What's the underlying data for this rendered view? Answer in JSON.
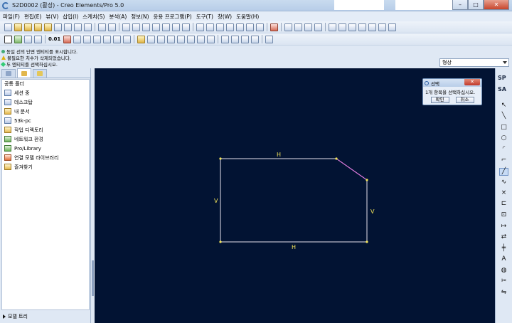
{
  "window": {
    "title": "S2D0002 (활성) - Creo Elements/Pro 5.0"
  },
  "menubar": [
    "파일(F)",
    "편집(E)",
    "뷰(V)",
    "삽입(I)",
    "스케치(S)",
    "분석(A)",
    "정보(N)",
    "응용 프로그램(P)",
    "도구(T)",
    "창(W)",
    "도움말(H)"
  ],
  "toolbar": {
    "scale_label": "0.01"
  },
  "messages": [
    "동일 선의 단면 엔티티를 표시합니다.",
    "불필요한 치수가 삭제되었습니다.",
    "두 엔티티를 선택하십시오."
  ],
  "filter": {
    "selected": "형상"
  },
  "left_panel": {
    "header": "공통 폴더",
    "folders": [
      {
        "label": "세션 중",
        "icon": "session-icon"
      },
      {
        "label": "데스크탑",
        "icon": "desktop-icon"
      },
      {
        "label": "내 문서",
        "icon": "documents-icon"
      },
      {
        "label": "53k-pc",
        "icon": "computer-icon"
      },
      {
        "label": "작업 디렉토리",
        "icon": "working-directory-icon"
      },
      {
        "label": "네트워크 환경",
        "icon": "network-icon"
      },
      {
        "label": "Pro/Library",
        "icon": "library-icon"
      },
      {
        "label": "연결 모델 라이브러리",
        "icon": "model-library-icon"
      },
      {
        "label": "즐겨찾기",
        "icon": "favorites-icon"
      }
    ],
    "model_tree_label": "모델 트리"
  },
  "sketch": {
    "labels": [
      {
        "name": "dim-top",
        "text": "H"
      },
      {
        "name": "dim-bottom",
        "text": "H"
      },
      {
        "name": "dim-left",
        "text": "V"
      },
      {
        "name": "dim-right",
        "text": "V"
      }
    ],
    "colors": {
      "background": "#021333",
      "lines": "#e7e1ec",
      "chamfer": "#e46ee0",
      "points": "#f3e45a",
      "labels": "#f3e45a"
    }
  },
  "dialog": {
    "title": "선택",
    "message": "1개 항목을 선택하십시오.",
    "ok_label": "확인",
    "cancel_label": "취소"
  },
  "right_toolbar": {
    "sp_label": "SP",
    "sa_label": "SA"
  }
}
